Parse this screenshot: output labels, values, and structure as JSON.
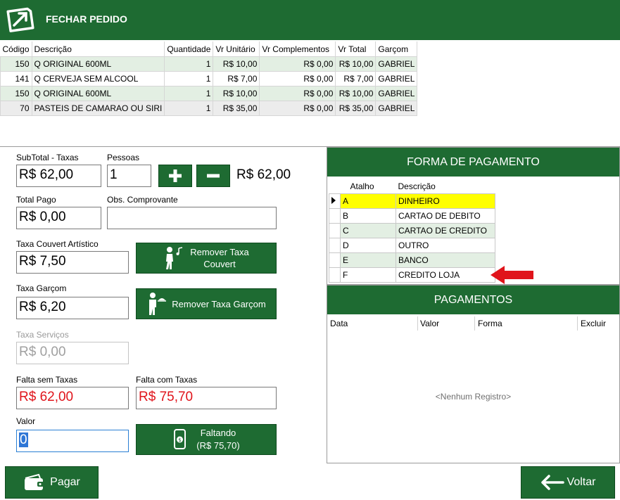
{
  "header": {
    "title": "FECHAR PEDIDO",
    "logo_icon": "arrow-box-icon"
  },
  "items": {
    "columns": [
      "Código",
      "Descrição",
      "Quantidade",
      "Vr Unitário",
      "Vr Complementos",
      "Vr Total",
      "Garçom"
    ],
    "rows": [
      [
        "150",
        "Q ORIGINAL 600ML",
        "1",
        "R$ 10,00",
        "R$ 0,00",
        "R$ 10,00",
        "GABRIEL"
      ],
      [
        "141",
        "Q CERVEJA SEM ALCOOL",
        "1",
        "R$ 7,00",
        "R$ 0,00",
        "R$ 7,00",
        "GABRIEL"
      ],
      [
        "150",
        "Q ORIGINAL 600ML",
        "1",
        "R$ 10,00",
        "R$ 0,00",
        "R$ 10,00",
        "GABRIEL"
      ],
      [
        "70",
        "PASTEIS DE CAMARAO OU SIRI",
        "1",
        "R$ 35,00",
        "R$ 0,00",
        "R$ 35,00",
        "GABRIEL"
      ]
    ]
  },
  "form": {
    "subtotal_label": "SubTotal - Taxas",
    "subtotal_value": "R$ 62,00",
    "pessoas_label": "Pessoas",
    "pessoas_value": "1",
    "per_person_value": "R$ 62,00",
    "total_pago_label": "Total Pago",
    "total_pago_value": "R$ 0,00",
    "obs_label": "Obs. Comprovante",
    "obs_value": "",
    "couvert_label": "Taxa Couvert Artístico",
    "couvert_value": "R$ 7,50",
    "remove_couvert_line1": "Remover Taxa",
    "remove_couvert_line2": "Couvert",
    "garcom_label": "Taxa Garçom",
    "garcom_value": "R$ 6,20",
    "remove_garcom": "Remover Taxa Garçom",
    "servicos_label": "Taxa Serviços",
    "servicos_value": "R$ 0,00",
    "falta_sem_label": "Falta sem Taxas",
    "falta_sem_value": "R$ 62,00",
    "falta_com_label": "Falta com Taxas",
    "falta_com_value": "R$ 75,70",
    "valor_label": "Valor",
    "valor_value": "0",
    "faltando_line1": "Faltando",
    "faltando_line2": "(R$ 75,70)"
  },
  "forma_pagamento": {
    "title": "FORMA DE PAGAMENTO",
    "columns": [
      "Atalho",
      "Descrição"
    ],
    "rows": [
      [
        "A",
        "DINHEIRO"
      ],
      [
        "B",
        "CARTAO DE DEBITO"
      ],
      [
        "C",
        "CARTAO DE CREDITO"
      ],
      [
        "D",
        "OUTRO"
      ],
      [
        "E",
        "BANCO"
      ],
      [
        "F",
        "CREDITO LOJA"
      ]
    ],
    "selected_color": "#ffff00"
  },
  "pagamentos": {
    "title": "PAGAMENTOS",
    "columns": [
      "Data",
      "Valor",
      "Forma",
      "Excluir"
    ],
    "empty_text": "<Nenhum Registro>"
  },
  "footer": {
    "pagar_label": "Pagar",
    "voltar_label": "Voltar"
  },
  "colors": {
    "brand": "#1e6b32",
    "alert_red": "#e0141b",
    "selected": "#ffff00"
  }
}
